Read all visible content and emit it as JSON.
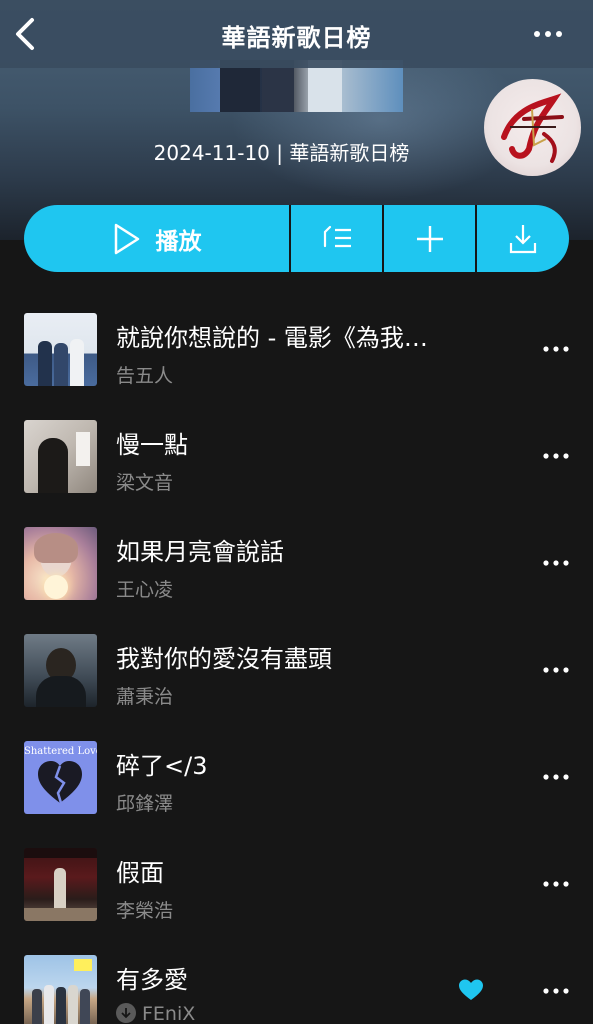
{
  "header": {
    "title": "華語新歌日榜",
    "back_icon": "chevron-left-icon",
    "more_icon": "more-horizontal-icon"
  },
  "playlist": {
    "subtitle": "2024-11-10 | 華語新歌日榜"
  },
  "actions": {
    "play_label": "播放",
    "play_icon": "play-icon",
    "buttons": [
      "queue-icon",
      "plus-icon",
      "download-icon"
    ],
    "accent_color": "#1fc6f0"
  },
  "songs": [
    {
      "title": "就說你想說的 - 電影《為我…",
      "artist": "告五人"
    },
    {
      "title": "慢一點",
      "artist": "梁文音"
    },
    {
      "title": "如果月亮會說話",
      "artist": "王心凌"
    },
    {
      "title": "我對你的愛沒有盡頭",
      "artist": "蕭秉治"
    },
    {
      "title": "碎了</3",
      "artist": "邱鋒澤",
      "cover_text": "Shattered Love"
    },
    {
      "title": "假面",
      "artist": "李榮浩"
    },
    {
      "title": "有多愛",
      "artist": "FEniX",
      "liked": true,
      "downloaded": true
    }
  ]
}
